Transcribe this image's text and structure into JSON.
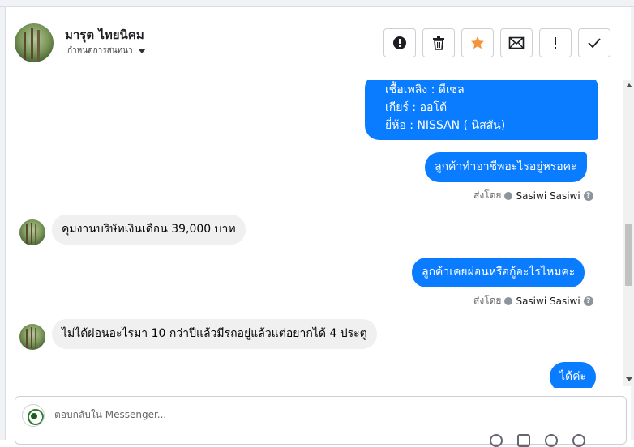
{
  "header": {
    "contact_name": "มารุต ไทยนิคม",
    "assign_label": "กำหนดการสนทนา",
    "actions": [
      {
        "name": "spam-button",
        "icon": "alert-circle-icon"
      },
      {
        "name": "delete-button",
        "icon": "trash-icon"
      },
      {
        "name": "star-button",
        "icon": "star-icon"
      },
      {
        "name": "mark-unread-button",
        "icon": "envelope-icon"
      },
      {
        "name": "follow-up-button",
        "icon": "exclamation-icon"
      },
      {
        "name": "mark-done-button",
        "icon": "check-icon"
      }
    ]
  },
  "colors": {
    "outgoing_bubble": "#0a7cff",
    "incoming_bubble": "#f0f0f0",
    "star": "#f7923a"
  },
  "messages": {
    "m1": {
      "lines": [
        "เชื้อเพลิง : ดีเซล",
        "เกียร์ : ออโต้",
        "ยี่ห้อ : NISSAN ( นิสสัน)"
      ],
      "direction": "out"
    },
    "m2": {
      "text": "ลูกค้าทำอาชีพอะไรอยู่หรอคะ",
      "direction": "out"
    },
    "m2_sent": {
      "prefix": "ส่งโดย",
      "sender": "Sasiwi Sasiwi"
    },
    "m3": {
      "text": "คุมงานบริษัทเงินเดือน 39,000 บาท",
      "direction": "in"
    },
    "m4": {
      "text": "ลูกค้าเคยผ่อนหรือกู้อะไรไหมคะ",
      "direction": "out"
    },
    "m4_sent": {
      "prefix": "ส่งโดย",
      "sender": "Sasiwi Sasiwi"
    },
    "m5": {
      "text": "ไม่ได้ผ่อนอะไรมา 10 กว่าปีแล้วมีรถอยู่แล้วแต่อยากได้ 4 ประตู",
      "direction": "in"
    },
    "m6": {
      "text": "ได้ค่ะ",
      "direction": "out"
    }
  },
  "composer": {
    "placeholder": "ตอบกลับใน Messenger..."
  }
}
